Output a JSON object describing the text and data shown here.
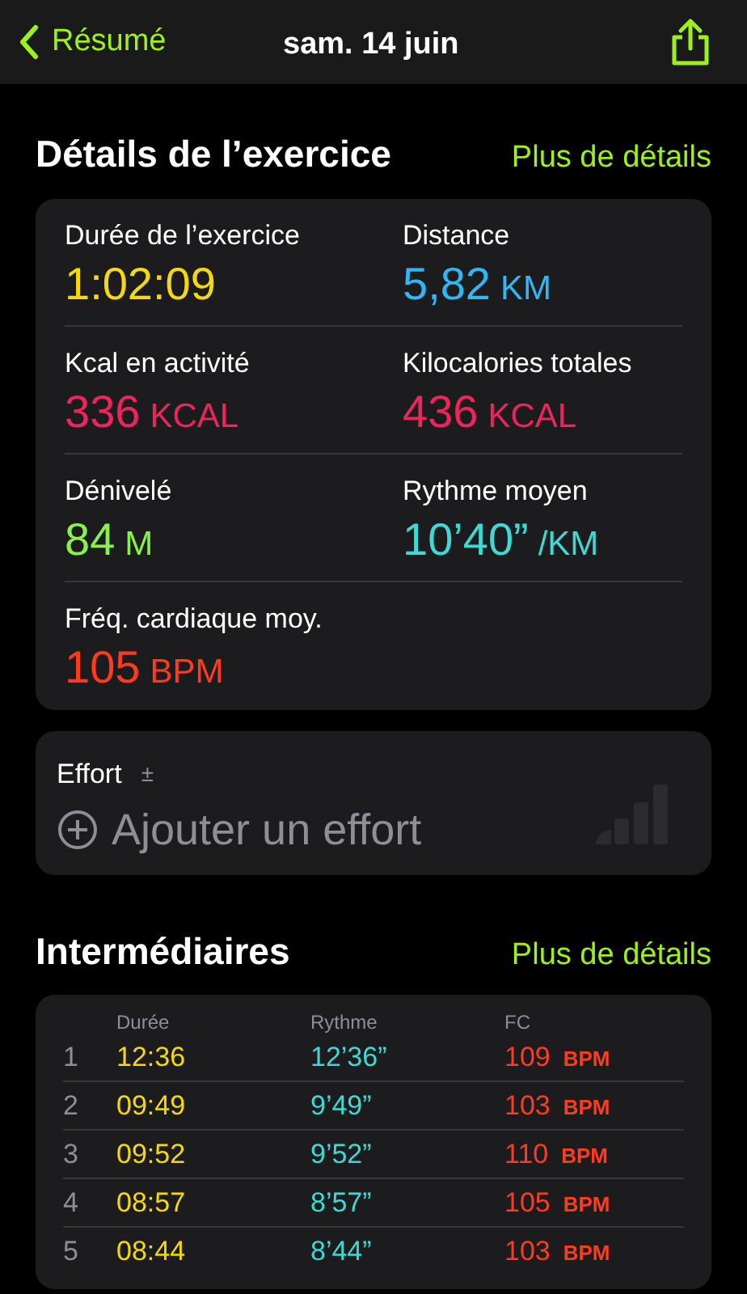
{
  "nav": {
    "back_label": "Résumé",
    "title": "sam. 14 juin"
  },
  "details": {
    "title": "Détails de l’exercice",
    "link": "Plus de détails",
    "metrics": [
      {
        "label": "Durée de l’exercice",
        "value": "1:02:09",
        "color": "#f5d90a"
      },
      {
        "label": "Distance",
        "value": "5,82",
        "unit": "KM",
        "color": "#2fb8f5"
      },
      {
        "label": "Kcal en activité",
        "value": "336",
        "unit": "KCAL",
        "color": "#f0245a"
      },
      {
        "label": "Kilocalories totales",
        "value": "436",
        "unit": "KCAL",
        "color": "#f0245a"
      },
      {
        "label": "Dénivelé",
        "value": "84",
        "unit": "M",
        "color": "#8cf04a"
      },
      {
        "label": "Rythme moyen",
        "value": "10’40”",
        "unit": "/KM",
        "color": "#3fd9d3"
      },
      {
        "label": "Fréq. cardiaque moy.",
        "value": "105",
        "unit": "BPM",
        "color": "#ff3b1f"
      }
    ]
  },
  "effort": {
    "label": "Effort",
    "symbol": "±",
    "action": "Ajouter un effort"
  },
  "splits": {
    "title": "Intermédiaires",
    "link": "Plus de détails",
    "columns": [
      "Durée",
      "Rythme",
      "FC"
    ],
    "rows": [
      {
        "index": "1",
        "duration": "12:36",
        "pace": "12’36”",
        "hr": "109",
        "unit": "BPM"
      },
      {
        "index": "2",
        "duration": "09:49",
        "pace": "9’49”",
        "hr": "103",
        "unit": "BPM"
      },
      {
        "index": "3",
        "duration": "09:52",
        "pace": "9’52”",
        "hr": "110",
        "unit": "BPM"
      },
      {
        "index": "4",
        "duration": "08:57",
        "pace": "8’57”",
        "hr": "105",
        "unit": "BPM"
      },
      {
        "index": "5",
        "duration": "08:44",
        "pace": "8’44”",
        "hr": "103",
        "unit": "BPM"
      }
    ]
  }
}
